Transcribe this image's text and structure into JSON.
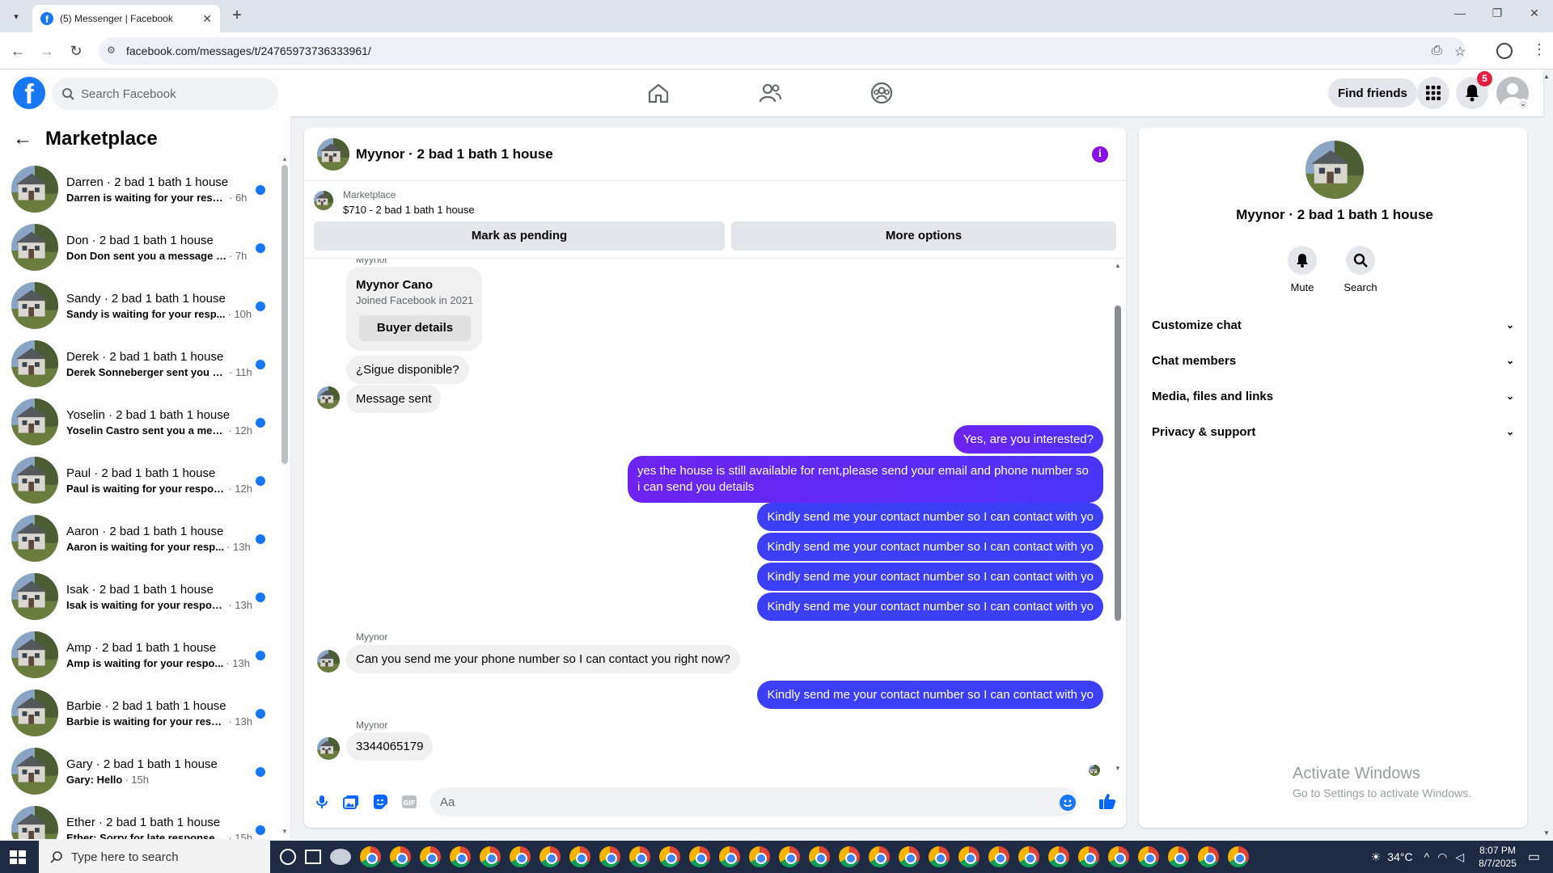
{
  "browser": {
    "tab_title": "(5) Messenger | Facebook",
    "url": "facebook.com/messages/t/24765973736333961/"
  },
  "fb_nav": {
    "search_placeholder": "Search Facebook",
    "find_friends": "Find friends",
    "notification_count": "5"
  },
  "sidebar": {
    "title": "Marketplace",
    "conversations": [
      {
        "name": "Darren · 2 bad 1 bath 1 house",
        "snippet": "Darren is waiting for your respo...",
        "time": "· 6h"
      },
      {
        "name": "Don · 2 bad 1 bath 1 house",
        "snippet": "Don Don sent you a message ab...",
        "time": "· 7h"
      },
      {
        "name": "Sandy · 2 bad 1 bath 1 house",
        "snippet": "Sandy is waiting for your resp...",
        "time": "· 10h"
      },
      {
        "name": "Derek · 2 bad 1 bath 1 house",
        "snippet": "Derek Sonneberger sent you a ...",
        "time": "· 11h"
      },
      {
        "name": "Yoselin · 2 bad 1 bath 1 house",
        "snippet": "Yoselin Castro sent you a mess...",
        "time": "· 12h"
      },
      {
        "name": "Paul · 2 bad 1 bath 1 house",
        "snippet": "Paul is waiting for your respon...",
        "time": "· 12h"
      },
      {
        "name": "Aaron · 2 bad 1 bath 1 house",
        "snippet": "Aaron is waiting for your resp...",
        "time": "· 13h"
      },
      {
        "name": "Isak · 2 bad 1 bath 1 house",
        "snippet": "Isak is waiting for your respon...",
        "time": "· 13h"
      },
      {
        "name": "Amp · 2 bad 1 bath 1 house",
        "snippet": "Amp is waiting for your respo...",
        "time": "· 13h"
      },
      {
        "name": "Barbie · 2 bad 1 bath 1 house",
        "snippet": "Barbie is waiting for your resp...",
        "time": "· 13h"
      },
      {
        "name": "Gary · 2 bad 1 bath 1 house",
        "snippet": "Gary: Hello",
        "time": "· 15h"
      },
      {
        "name": "Ether · 2 bad 1 bath 1 house",
        "snippet": "Ether: Sorry for late response ...",
        "time": "· 15h"
      }
    ]
  },
  "chat": {
    "title": "Myynor · 2 bad 1 bath 1 house",
    "marketplace_label": "Marketplace",
    "listing": "$710 - 2 bad 1 bath 1 house",
    "mark_pending": "Mark as pending",
    "more_options": "More options",
    "sender_name": "Myynor",
    "card": {
      "name": "Myynor Cano",
      "joined": "Joined Facebook in 2021",
      "button": "Buyer details"
    },
    "msg_disponible": "¿Sigue disponible?",
    "msg_sent": "Message sent",
    "out_interested": "Yes, are you interested?",
    "out_available": "yes the house is still available for rent,please send your email and phone number so i can send you details",
    "out_kindly": "Kindly send me your contact number so I can contact with yo",
    "in_phone_request": "Can you send me your phone number so I can contact you right now?",
    "in_number": "3344065179",
    "composer_placeholder": "Aa"
  },
  "info_panel": {
    "title": "Myynor · 2 bad 1 bath 1 house",
    "mute": "Mute",
    "search": "Search",
    "sections": [
      "Customize chat",
      "Chat members",
      "Media, files and links",
      "Privacy & support"
    ]
  },
  "watermark": {
    "line1": "Activate Windows",
    "line2": "Go to Settings to activate Windows."
  },
  "taskbar": {
    "search_placeholder": "Type here to search",
    "temperature": "34°C",
    "time": "8:07 PM",
    "date": "8/7/2025"
  },
  "colors": {
    "fb_blue": "#1877f2",
    "messenger_purple": "#6e23f0",
    "unread_dot": "#1877f2",
    "badge_red": "#e41e3f"
  }
}
